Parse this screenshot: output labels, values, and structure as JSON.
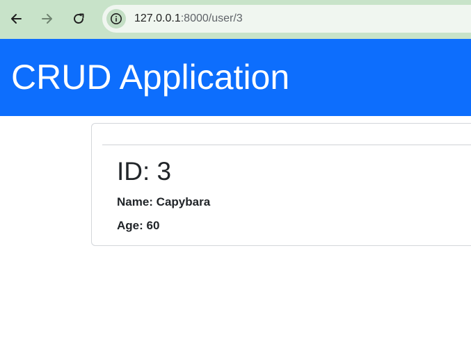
{
  "browser": {
    "url_host": "127.0.0.1",
    "url_rest": ":8000/user/3",
    "icons": {
      "back": "arrow-left-icon",
      "forward": "arrow-right-icon",
      "reload": "reload-icon",
      "site_info": "info-icon"
    }
  },
  "header": {
    "title": "CRUD Application",
    "background_color": "#0d6efd"
  },
  "user_card": {
    "id_text": "ID: 3",
    "name_text": "Name: Capybara",
    "age_text": "Age: 60"
  }
}
